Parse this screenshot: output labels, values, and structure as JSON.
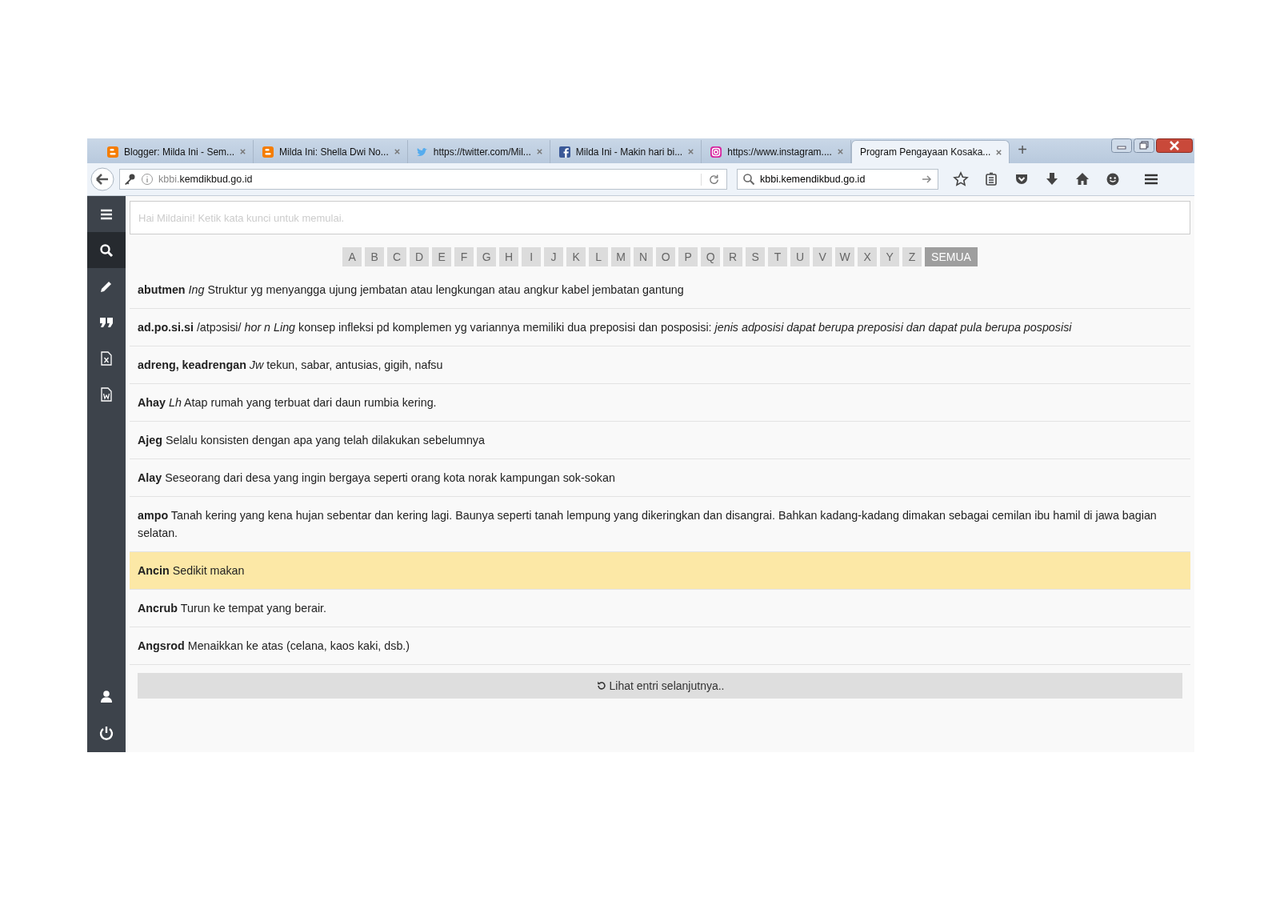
{
  "tabs": [
    {
      "kind": "blogger",
      "title": "Blogger: Milda Ini - Sem...",
      "selected": false
    },
    {
      "kind": "blogger",
      "title": "Milda Ini: Shella Dwi No...",
      "selected": false
    },
    {
      "kind": "twitter",
      "title": "https://twitter.com/Mil...",
      "selected": false
    },
    {
      "kind": "facebook",
      "title": "Milda Ini - Makin hari bi...",
      "selected": false
    },
    {
      "kind": "instagram",
      "title": "https://www.instagram....",
      "selected": false
    },
    {
      "title": "Program Pengayaan Kosaka...",
      "selected": true
    }
  ],
  "new_tab": "+",
  "address_bar": {
    "prefix": "kbbi.",
    "domain": "kemdikbud.go.id"
  },
  "search_bar": {
    "value": "kbbi.kemendikbud.go.id"
  },
  "sidebar": {
    "items": [
      {
        "kind": "menu",
        "selected": false
      },
      {
        "kind": "search",
        "selected": true
      },
      {
        "kind": "pencil",
        "selected": false
      },
      {
        "kind": "quote",
        "selected": false
      },
      {
        "kind": "excel",
        "selected": false
      },
      {
        "kind": "word",
        "selected": false
      }
    ],
    "bottom_items": [
      {
        "kind": "user",
        "selected": false
      },
      {
        "kind": "power",
        "selected": false
      }
    ]
  },
  "search": {
    "placeholder": "Hai Mildaini! Ketik kata kunci untuk memulai."
  },
  "letters": [
    {
      "label": "A",
      "selected": false
    },
    {
      "label": "B",
      "selected": false
    },
    {
      "label": "C",
      "selected": false
    },
    {
      "label": "D",
      "selected": false
    },
    {
      "label": "E",
      "selected": false
    },
    {
      "label": "F",
      "selected": false
    },
    {
      "label": "G",
      "selected": false
    },
    {
      "label": "H",
      "selected": false
    },
    {
      "label": "I",
      "selected": false
    },
    {
      "label": "J",
      "selected": false
    },
    {
      "label": "K",
      "selected": false
    },
    {
      "label": "L",
      "selected": false
    },
    {
      "label": "M",
      "selected": false
    },
    {
      "label": "N",
      "selected": false
    },
    {
      "label": "O",
      "selected": false
    },
    {
      "label": "P",
      "selected": false
    },
    {
      "label": "Q",
      "selected": false
    },
    {
      "label": "R",
      "selected": false
    },
    {
      "label": "S",
      "selected": false
    },
    {
      "label": "T",
      "selected": false
    },
    {
      "label": "U",
      "selected": false
    },
    {
      "label": "V",
      "selected": false
    },
    {
      "label": "W",
      "selected": false
    },
    {
      "label": "X",
      "selected": false
    },
    {
      "label": "Y",
      "selected": false
    },
    {
      "label": "Z",
      "selected": false
    },
    {
      "label": "SEMUA",
      "selected": true
    }
  ],
  "entries": [
    {
      "text": "**abutmen** *Ing* Struktur yg menyangga ujung jembatan atau lengkungan atau angkur kabel jembatan gantung",
      "highlighted": false
    },
    {
      "text": "**ad.po.si.si** /atpɔsisi/ *hor n Ling* konsep infleksi pd komplemen yg variannya memiliki dua preposisi dan posposisi: *jenis adposisi dapat berupa preposisi dan dapat pula berupa posposisi*",
      "highlighted": false
    },
    {
      "text": "**adreng, keadrengan** *Jw* tekun, sabar, antusias, gigih, nafsu",
      "highlighted": false
    },
    {
      "text": "**Ahay** *Lh* Atap rumah yang terbuat dari daun rumbia kering.",
      "highlighted": false
    },
    {
      "text": "**Ajeg** Selalu konsisten dengan apa yang telah dilakukan sebelumnya",
      "highlighted": false
    },
    {
      "text": "**Alay** Seseorang dari desa yang ingin bergaya seperti orang kota norak kampungan sok-sokan",
      "highlighted": false
    },
    {
      "text": "**ampo** Tanah kering yang kena hujan sebentar dan kering lagi. Baunya seperti tanah lempung yang dikeringkan dan disangrai. Bahkan kadang-kadang dimakan sebagai cemilan ibu hamil di jawa bagian selatan.",
      "highlighted": false
    },
    {
      "text": "**Ancin** Sedikit makan",
      "highlighted": true
    },
    {
      "text": "**Ancrub** Turun ke tempat yang berair.",
      "highlighted": false
    },
    {
      "text": "**Angsrod** Menaikkan ke atas (celana, kaos kaki, dsb.)",
      "highlighted": false
    }
  ],
  "load_more": "Lihat entri selanjutnya.."
}
